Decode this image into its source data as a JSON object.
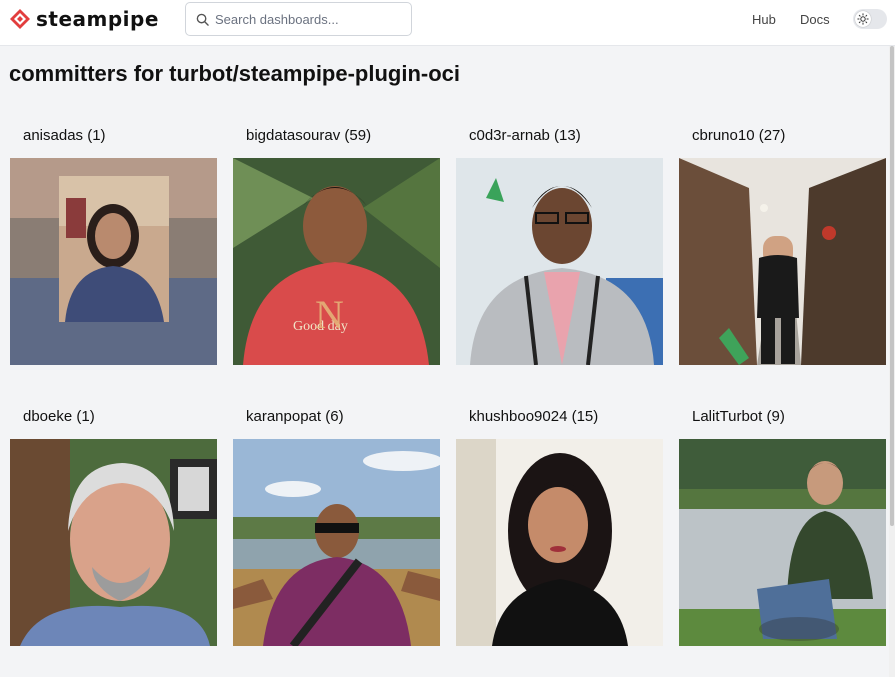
{
  "header": {
    "logo_text": "steampipe",
    "search_placeholder": "Search dashboards...",
    "nav": {
      "hub": "Hub",
      "docs": "Docs"
    },
    "brand_color": "#e23e3e"
  },
  "page": {
    "title": "committers for turbot/steampipe-plugin-oci"
  },
  "committers": [
    {
      "label": "anisadas (1)"
    },
    {
      "label": "bigdatasourav (59)"
    },
    {
      "label": "c0d3r-arnab (13)"
    },
    {
      "label": "cbruno10 (27)"
    },
    {
      "label": "dboeke (1)"
    },
    {
      "label": "karanpopat (6)"
    },
    {
      "label": "khushboo9024 (15)"
    },
    {
      "label": "LalitTurbot (9)"
    }
  ]
}
